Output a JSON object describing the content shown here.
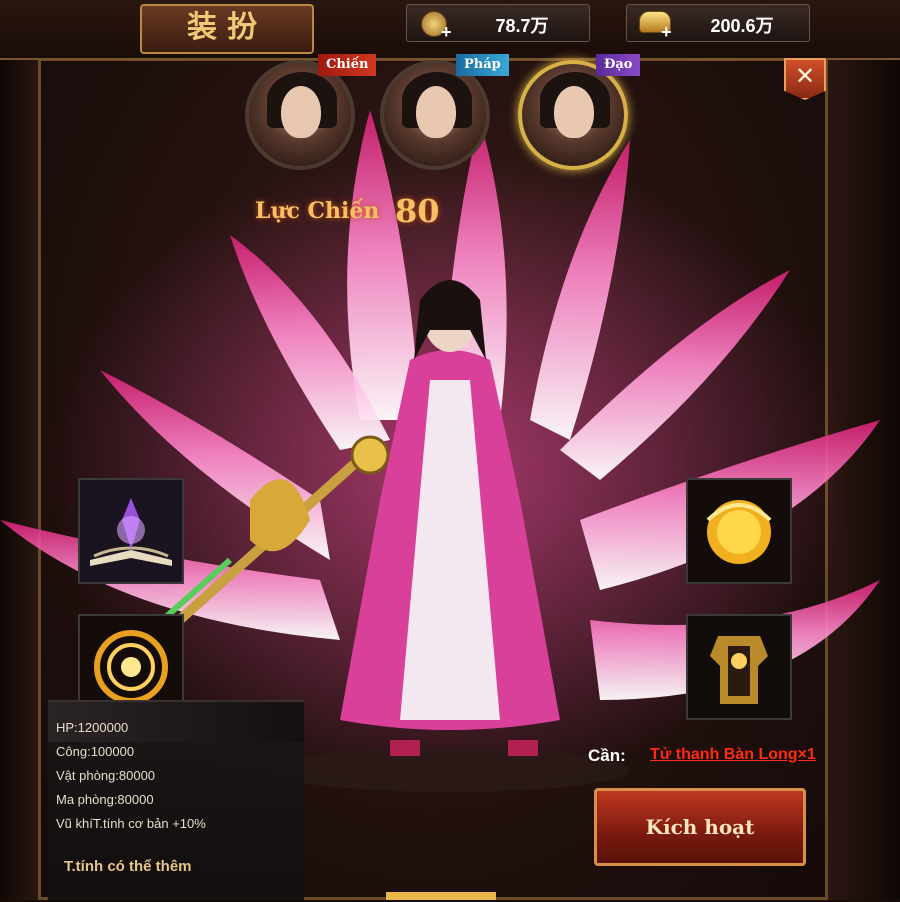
{
  "header": {
    "title": "装扮",
    "currencies": [
      {
        "icon": "coin-icon",
        "value": "78.7万"
      },
      {
        "icon": "ingot-icon",
        "value": "200.6万"
      }
    ]
  },
  "characters": [
    {
      "class_label": "Chiến",
      "selected": false,
      "tag_color": "#c02818"
    },
    {
      "class_label": "Pháp",
      "selected": false,
      "tag_color": "#2a90c8"
    },
    {
      "class_label": "Đạo",
      "selected": true,
      "tag_color": "#7a3ab8"
    }
  ],
  "power": {
    "label": "Lực Chiến",
    "value": "80"
  },
  "stats": [
    "HP:1200000",
    "Công:100000",
    "Vật phòng:80000",
    "Ma phòng:80000",
    "Vũ khíT.tính cơ bản +10%"
  ],
  "more_attrs_label": "T.tính có thể thêm",
  "requirement": {
    "label": "Cần:",
    "item": "Tử thanh Bàn Long×1"
  },
  "activate_button": "Kích hoạt",
  "colors": {
    "accent_gold": "#d8b048",
    "tail_pink": "#ff5aa8",
    "link_red": "#ff2a10"
  }
}
